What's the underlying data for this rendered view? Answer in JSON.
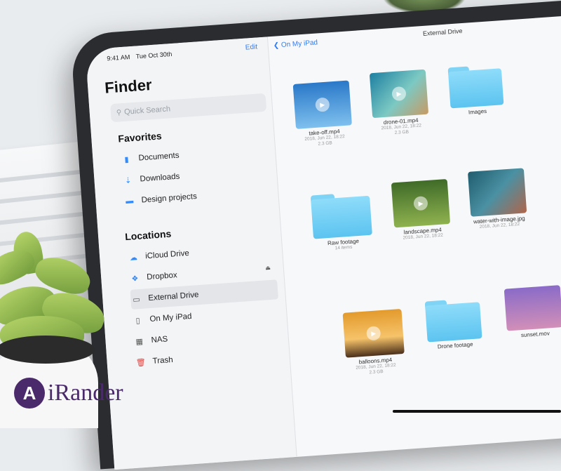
{
  "status_bar": {
    "time": "9:41 AM",
    "date": "Tue Oct 30th"
  },
  "sidebar": {
    "edit_label": "Edit",
    "title": "Finder",
    "search_placeholder": "Quick Search",
    "favorites": {
      "heading": "Favorites",
      "items": [
        {
          "label": "Documents",
          "icon": "document-icon"
        },
        {
          "label": "Downloads",
          "icon": "download-icon"
        },
        {
          "label": "Design projects",
          "icon": "folder-icon"
        }
      ]
    },
    "locations": {
      "heading": "Locations",
      "items": [
        {
          "label": "iCloud Drive",
          "icon": "cloud-icon"
        },
        {
          "label": "Dropbox",
          "icon": "dropbox-icon"
        },
        {
          "label": "External Drive",
          "icon": "drive-icon",
          "selected": true
        },
        {
          "label": "On My iPad",
          "icon": "ipad-icon"
        },
        {
          "label": "NAS",
          "icon": "server-icon"
        },
        {
          "label": "Trash",
          "icon": "trash-icon"
        }
      ]
    }
  },
  "main": {
    "back_label": "On My iPad",
    "title": "External Drive",
    "items": [
      {
        "name": "take-off.mp4",
        "meta1": "2018, Jun 22, 18:22",
        "meta2": "2.3 GB",
        "type": "video"
      },
      {
        "name": "drone-01.mp4",
        "meta1": "2018, Jun 22, 18:22",
        "meta2": "2.3 GB",
        "type": "video"
      },
      {
        "name": "Images",
        "meta1": "",
        "meta2": "",
        "type": "folder"
      },
      {
        "name": "Raw footage",
        "meta1": "14 items",
        "meta2": "",
        "type": "folder"
      },
      {
        "name": "landscape.mp4",
        "meta1": "2018, Jun 22, 18:22",
        "meta2": "",
        "type": "video"
      },
      {
        "name": "water-with-image.jpg",
        "meta1": "2018, Jun 22, 18:22",
        "meta2": "",
        "type": "image"
      },
      {
        "name": "balloons.mp4",
        "meta1": "2018, Jun 22, 18:22",
        "meta2": "2.3 GB",
        "type": "video"
      },
      {
        "name": "Drone footage",
        "meta1": "",
        "meta2": "",
        "type": "folder"
      },
      {
        "name": "sunset.mov",
        "meta1": "",
        "meta2": "",
        "type": "video"
      }
    ]
  },
  "watermark": {
    "logo_letter": "A",
    "text": "iRander"
  },
  "colors": {
    "accent": "#2f7cf6",
    "folder": "#5cc4f0",
    "brand": "#4b2a6b"
  }
}
